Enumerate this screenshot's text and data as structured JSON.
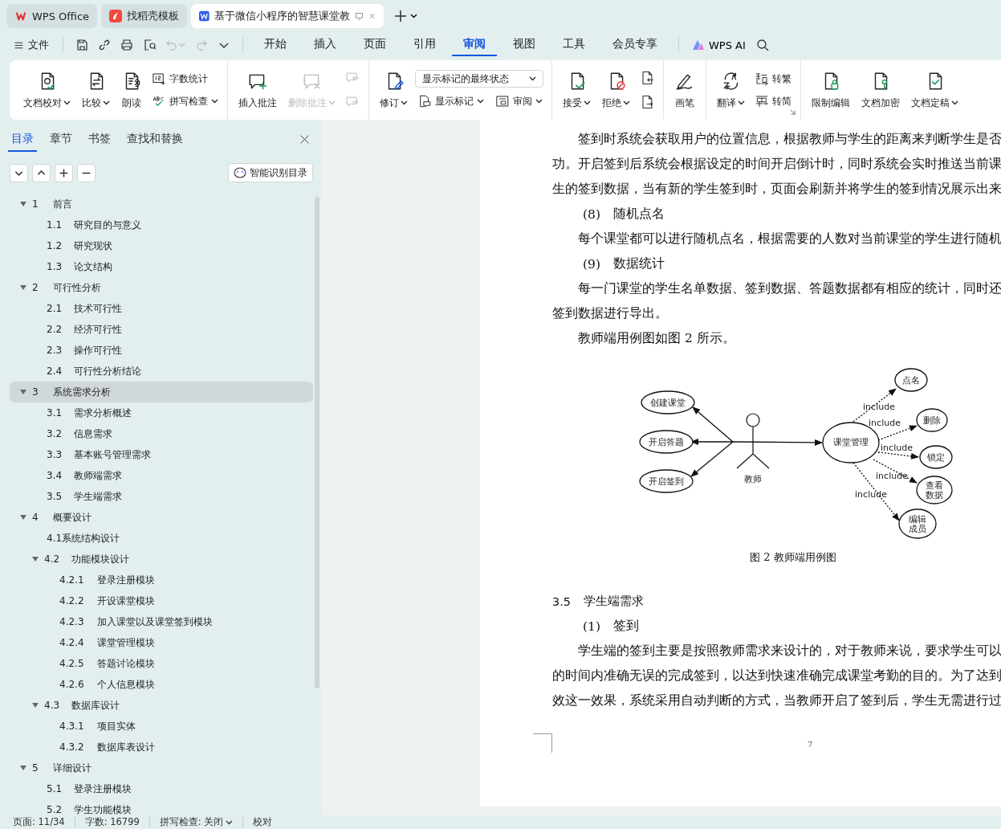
{
  "title_tabs": [
    {
      "label": "WPS Office",
      "kind": "home",
      "selected": false
    },
    {
      "label": "找稻壳模板",
      "kind": "template",
      "selected": false
    },
    {
      "label": "基于微信小程序的智慧课堂教",
      "kind": "document",
      "selected": true
    }
  ],
  "menu": {
    "file": "文件",
    "quick_access": [
      {
        "kind": "save",
        "disabled": false
      },
      {
        "kind": "link",
        "disabled": false
      },
      {
        "kind": "print",
        "disabled": false
      },
      {
        "kind": "preview",
        "disabled": false
      },
      {
        "kind": "undo",
        "disabled": true
      },
      {
        "kind": "redo",
        "disabled": true
      },
      {
        "kind": "more",
        "disabled": false
      }
    ],
    "tabs": [
      {
        "label": "开始",
        "selected": false
      },
      {
        "label": "插入",
        "selected": false
      },
      {
        "label": "页面",
        "selected": false
      },
      {
        "label": "引用",
        "selected": false
      },
      {
        "label": "审阅",
        "selected": true
      },
      {
        "label": "视图",
        "selected": false
      },
      {
        "label": "工具",
        "selected": false
      },
      {
        "label": "会员专享",
        "selected": false
      }
    ],
    "ai": "WPS AI"
  },
  "ribbon": {
    "groups": [
      {
        "items": [
          {
            "kind": "large",
            "label": "文档校对",
            "caret": true,
            "disabled": false
          },
          {
            "kind": "large",
            "label": "比较",
            "caret": true,
            "disabled": false
          },
          {
            "kind": "large",
            "label": "朗读",
            "caret": false,
            "disabled": false
          },
          {
            "kind": "column",
            "items": [
              {
                "kind": "small",
                "label": "字数统计",
                "caret": false,
                "disabled": false
              },
              {
                "kind": "small",
                "label": "拼写检查",
                "caret": true,
                "disabled": false
              }
            ]
          }
        ]
      },
      {
        "items": [
          {
            "kind": "large",
            "label": "插入批注",
            "caret": false,
            "disabled": false
          },
          {
            "kind": "large",
            "label": "删除批注",
            "caret": true,
            "disabled": true
          },
          {
            "kind": "column",
            "items": [
              {
                "kind": "icon",
                "disabled": true
              },
              {
                "kind": "icon",
                "disabled": true
              }
            ]
          }
        ]
      },
      {
        "items": [
          {
            "kind": "large",
            "label": "修订",
            "caret": true,
            "disabled": false
          },
          {
            "kind": "column",
            "items": [
              {
                "kind": "dropdown",
                "value": "显示标记的最终状态"
              },
              {
                "kind": "row",
                "items": [
                  {
                    "kind": "small",
                    "label": "显示标记",
                    "caret": true,
                    "disabled": false
                  },
                  {
                    "kind": "small",
                    "label": "审阅",
                    "caret": true,
                    "disabled": false
                  }
                ]
              }
            ]
          }
        ]
      },
      {
        "items": [
          {
            "kind": "large",
            "label": "接受",
            "caret": true,
            "disabled": false
          },
          {
            "kind": "large",
            "label": "拒绝",
            "caret": true,
            "disabled": false
          },
          {
            "kind": "column",
            "items": [
              {
                "kind": "icon",
                "disabled": false
              },
              {
                "kind": "icon",
                "disabled": false
              }
            ]
          }
        ]
      },
      {
        "items": [
          {
            "kind": "large",
            "label": "画笔",
            "caret": false,
            "disabled": false
          }
        ]
      },
      {
        "items": [
          {
            "kind": "large",
            "label": "翻译",
            "caret": true,
            "disabled": false
          },
          {
            "kind": "column",
            "items": [
              {
                "kind": "small",
                "label": "转繁",
                "caret": false,
                "disabled": false
              },
              {
                "kind": "small",
                "label": "转简",
                "caret": false,
                "disabled": false
              }
            ]
          }
        ],
        "launcher": true
      },
      {
        "items": [
          {
            "kind": "large",
            "label": "限制编辑",
            "caret": false,
            "disabled": false
          },
          {
            "kind": "large",
            "label": "文档加密",
            "caret": false,
            "disabled": false
          },
          {
            "kind": "large",
            "label": "文档定稿",
            "caret": true,
            "disabled": false
          }
        ]
      }
    ]
  },
  "nav_pane": {
    "tabs": [
      {
        "label": "目录",
        "selected": true
      },
      {
        "label": "章节",
        "selected": false
      },
      {
        "label": "书签",
        "selected": false
      },
      {
        "label": "查找和替换",
        "selected": false
      }
    ],
    "smart_button": "智能识别目录",
    "toc": [
      {
        "number": "1",
        "title": "前言",
        "selected": false,
        "expanded": true,
        "children": [
          {
            "number": "1.1",
            "title": "研究目的与意义",
            "selected": false
          },
          {
            "number": "1.2",
            "title": "研究现状",
            "selected": false
          },
          {
            "number": "1.3",
            "title": "论文结构",
            "selected": false
          }
        ]
      },
      {
        "number": "2",
        "title": "可行性分析",
        "selected": false,
        "expanded": true,
        "children": [
          {
            "number": "2.1",
            "title": "技术可行性",
            "selected": false
          },
          {
            "number": "2.2",
            "title": "经济可行性",
            "selected": false
          },
          {
            "number": "2.3",
            "title": "操作可行性",
            "selected": false
          },
          {
            "number": "2.4",
            "title": "可行性分析结论",
            "selected": false
          }
        ]
      },
      {
        "number": "3",
        "title": "系统需求分析",
        "selected": true,
        "expanded": true,
        "children": [
          {
            "number": "3.1",
            "title": "需求分析概述",
            "selected": false
          },
          {
            "number": "3.2",
            "title": "信息需求",
            "selected": false
          },
          {
            "number": "3.3",
            "title": "基本账号管理需求",
            "selected": false
          },
          {
            "number": "3.4",
            "title": "教师端需求",
            "selected": false
          },
          {
            "number": "3.5",
            "title": "学生端需求",
            "selected": false
          }
        ]
      },
      {
        "number": "4",
        "title": "概要设计",
        "selected": false,
        "expanded": true,
        "children": [
          {
            "title": "4.1系统结构设计",
            "selected": false
          },
          {
            "number": "4.2",
            "title": "功能模块设计",
            "selected": false,
            "expanded": true,
            "children": [
              {
                "number": "4.2.1",
                "title": "登录注册模块",
                "selected": false
              },
              {
                "number": "4.2.2",
                "title": "开设课堂模块",
                "selected": false
              },
              {
                "number": "4.2.3",
                "title": "加入课堂以及课堂签到模块",
                "selected": false
              },
              {
                "number": "4.2.4",
                "title": "课堂管理模块",
                "selected": false
              },
              {
                "number": "4.2.5",
                "title": "答题讨论模块",
                "selected": false
              },
              {
                "number": "4.2.6",
                "title": "个人信息模块",
                "selected": false
              }
            ]
          },
          {
            "number": "4.3",
            "title": "数据库设计",
            "selected": false,
            "expanded": true,
            "children": [
              {
                "number": "4.3.1",
                "title": "项目实体",
                "selected": false
              },
              {
                "number": "4.3.2",
                "title": "数据库表设计",
                "selected": false
              }
            ]
          }
        ]
      },
      {
        "number": "5",
        "title": "详细设计",
        "selected": false,
        "expanded": true,
        "children": [
          {
            "number": "5.1",
            "title": "登录注册模块",
            "selected": false
          },
          {
            "number": "5.2",
            "title": "学生功能模块",
            "selected": false
          }
        ]
      }
    ]
  },
  "document": {
    "blocks": [
      {
        "kind": "text",
        "indent": true,
        "text": "签到时系统会获取用户的位置信息，根据教师与学生的距离来判断学生是否"
      },
      {
        "kind": "text",
        "indent": false,
        "text": "功。开启签到后系统会根据设定的时间开启倒计时，同时系统会实时推送当前课"
      },
      {
        "kind": "text",
        "indent": false,
        "text": "生的签到数据，当有新的学生签到时，页面会刷新并将学生的签到情况展示出来"
      },
      {
        "kind": "heading",
        "number": "(8)",
        "text": "随机点名"
      },
      {
        "kind": "text",
        "indent": true,
        "text": "每个课堂都可以进行随机点名，根据需要的人数对当前课堂的学生进行随机"
      },
      {
        "kind": "heading",
        "number": "(9)",
        "text": "数据统计"
      },
      {
        "kind": "text",
        "indent": true,
        "text": "每一门课堂的学生名单数据、签到数据、答题数据都有相应的统计，同时还"
      },
      {
        "kind": "text",
        "indent": false,
        "text": "签到数据进行导出。"
      },
      {
        "kind": "text",
        "indent": true,
        "text": "教师端用例图如图 2 所示。"
      },
      {
        "kind": "figure",
        "actor": "教师",
        "left_cases": [
          "创建课堂",
          "开启答题",
          "开启签到"
        ],
        "hub": "课堂管理",
        "included": [
          {
            "name": "点名",
            "relation": "include"
          },
          {
            "name": "删除",
            "relation": "include"
          },
          {
            "name": "锁定",
            "relation": "include"
          },
          {
            "name": "查看数据",
            "relation": "include"
          },
          {
            "name": "编辑成员",
            "relation": "include"
          }
        ]
      },
      {
        "kind": "caption",
        "text": "图 2  教师端用例图"
      },
      {
        "kind": "section",
        "number": "3.5",
        "text": "学生端需求"
      },
      {
        "kind": "heading",
        "number": "(1)",
        "text": "签到"
      },
      {
        "kind": "text",
        "indent": true,
        "text": "学生端的签到主要是按照教师需求来设计的，对于教师来说，要求学生可以"
      },
      {
        "kind": "text",
        "indent": false,
        "text": "的时间内准确无误的完成签到，以达到快速准确完成课堂考勤的目的。为了达到"
      },
      {
        "kind": "text",
        "indent": false,
        "text": "效这一效果，系统采用自动判断的方式，当教师开启了签到后，学生无需进行过"
      }
    ],
    "page_number": "7"
  },
  "status_bar": {
    "items": [
      {
        "text": "页面: 11/34",
        "caret": false
      },
      {
        "text": "字数: 16799",
        "caret": false
      },
      {
        "text": "拼写检查: 关闭",
        "caret": true
      },
      {
        "text": "校对",
        "caret": false
      }
    ]
  }
}
